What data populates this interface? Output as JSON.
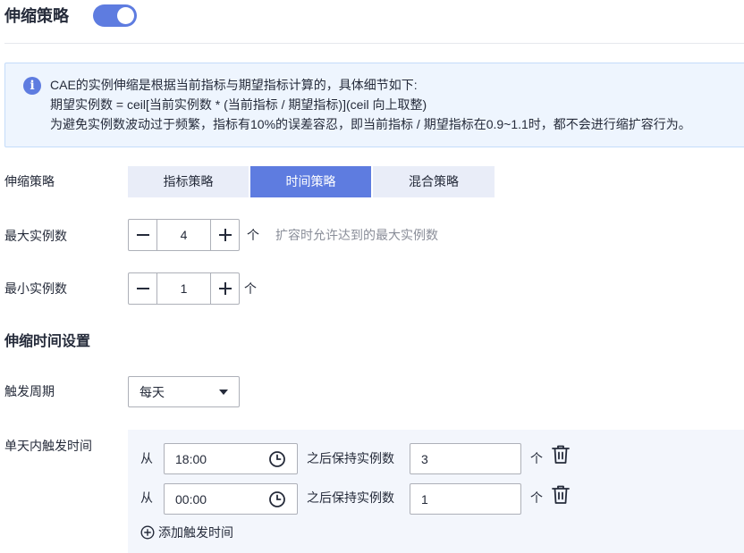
{
  "header": {
    "title": "伸缩策略",
    "toggle_on": true
  },
  "info": {
    "line1": "CAE的实例伸缩是根据当前指标与期望指标计算的，具体细节如下:",
    "line2": "期望实例数 = ceil[当前实例数 * (当前指标 / 期望指标)](ceil 向上取整)",
    "line3": "为避免实例数波动过于频繁，指标有10%的误差容忍，即当前指标 / 期望指标在0.9~1.1时，都不会进行缩扩容行为。"
  },
  "policy": {
    "label": "伸缩策略",
    "options": [
      "指标策略",
      "时间策略",
      "混合策略"
    ],
    "selected": "时间策略"
  },
  "max_instances": {
    "label": "最大实例数",
    "value": "4",
    "unit": "个",
    "hint": "扩容时允许达到的最大实例数"
  },
  "min_instances": {
    "label": "最小实例数",
    "value": "1",
    "unit": "个"
  },
  "schedule": {
    "section_title": "伸缩时间设置",
    "period_label": "触发周期",
    "period_value": "每天",
    "daily_label": "单天内触发时间",
    "from_text": "从",
    "keep_text": "之后保持实例数",
    "unit": "个",
    "triggers": [
      {
        "time": "18:00",
        "instances": "3"
      },
      {
        "time": "00:00",
        "instances": "1"
      }
    ],
    "add_label": "添加触发时间"
  },
  "colors": {
    "accent": "#5e7ce0",
    "info_bg": "#eef5fe",
    "panel_bg": "#f3f6fc",
    "segment_bg": "#e9edf8"
  }
}
